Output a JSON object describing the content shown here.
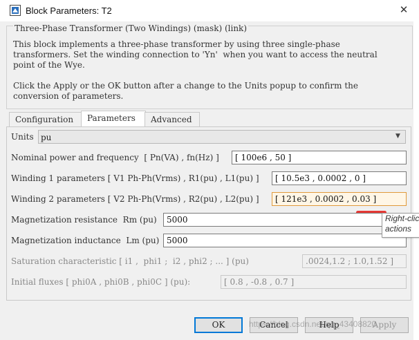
{
  "window": {
    "title": "Block Parameters: T2",
    "close_glyph": "✕"
  },
  "description": {
    "legend": "Three-Phase Transformer (Two Windings) (mask) (link)",
    "lines": [
      "This block implements a three-phase transformer by using three single-phase",
      "transformers. Set the winding connection to 'Yn'  when you want to access the neutral",
      "point of the Wye.",
      "",
      "Click the Apply or the OK button after a change to the Units popup to confirm the",
      "conversion of parameters."
    ]
  },
  "tabs": [
    {
      "label": "Configuration",
      "active": false
    },
    {
      "label": "Parameters",
      "active": true
    },
    {
      "label": "Advanced",
      "active": false
    }
  ],
  "params": {
    "units": {
      "label": "Units",
      "value": "pu"
    },
    "nominal": {
      "label": "Nominal power and frequency  [ Pn(VA) , fn(Hz) ]",
      "value": "[ 100e6 , 50 ]"
    },
    "winding1": {
      "label": "Winding 1 parameters [ V1 Ph-Ph(Vrms) , R1(pu) , L1(pu) ]",
      "value": "[ 10.5e3 , 0.0002 , 0 ]"
    },
    "winding2": {
      "label": "Winding 2 parameters [ V2 Ph-Ph(Vrms) , R2(pu) , L2(pu) ]",
      "value": "[ 121e3 , 0.0002 , 0.03 ]"
    },
    "mag_res": {
      "label": "Magnetization resistance  Rm (pu)",
      "value": "5000"
    },
    "mag_ind": {
      "label": "Magnetization inductance  Lm (pu)",
      "value": "5000"
    },
    "saturation": {
      "label": "Saturation characteristic [ i1 ,  phi1 ;  i2 , phi2 ; ... ] (pu)",
      "value": ".0024,1.2 ; 1.0,1.52 ]"
    },
    "fluxes": {
      "label": "Initial fluxes [ phi0A , phi0B , phi0C ] (pu):",
      "value": "[ 0.8 , -0.8 , 0.7 ]"
    }
  },
  "tooltip": {
    "line1": "Right-clic",
    "line2": "actions"
  },
  "buttons": {
    "ok": "OK",
    "cancel": "Cancel",
    "help": "Help",
    "apply": "Apply"
  },
  "watermark": "https://blog.csdn.net/qq_43408820"
}
